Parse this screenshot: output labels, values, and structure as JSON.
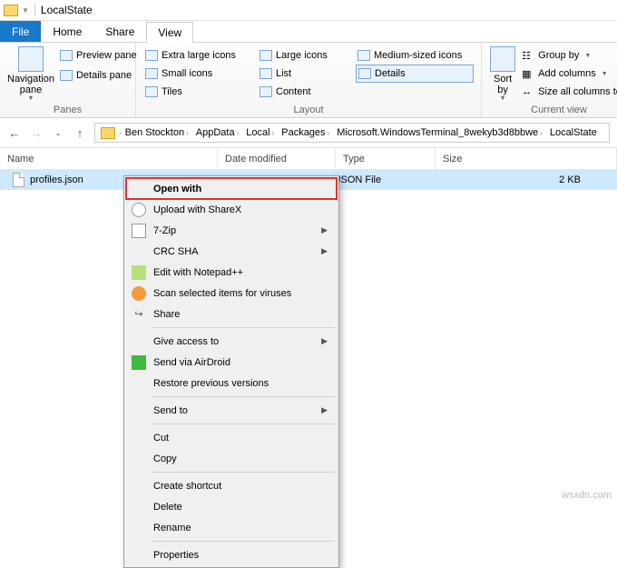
{
  "title": "LocalState",
  "tabs": {
    "file": "File",
    "home": "Home",
    "share": "Share",
    "view": "View"
  },
  "ribbon": {
    "panes": {
      "nav": "Navigation\npane",
      "preview": "Preview pane",
      "details": "Details pane",
      "group": "Panes"
    },
    "layout": {
      "xlarge": "Extra large icons",
      "large": "Large icons",
      "medium": "Medium-sized icons",
      "small": "Small icons",
      "list": "List",
      "details": "Details",
      "tiles": "Tiles",
      "content": "Content",
      "group": "Layout"
    },
    "current": {
      "sort": "Sort\nby",
      "groupby": "Group by",
      "addcols": "Add columns",
      "sizecols": "Size all columns to f",
      "group": "Current view"
    }
  },
  "breadcrumbs": [
    "Ben Stockton",
    "AppData",
    "Local",
    "Packages",
    "Microsoft.WindowsTerminal_8wekyb3d8bbwe",
    "LocalState"
  ],
  "columns": {
    "name": "Name",
    "date": "Date modified",
    "type": "Type",
    "size": "Size"
  },
  "file": {
    "name": "profiles.json",
    "date": "",
    "type": "JSON File",
    "size": "2 KB"
  },
  "context_menu": {
    "open_with": "Open with",
    "sharex": "Upload with ShareX",
    "sevenzip": "7-Zip",
    "crc": "CRC SHA",
    "notepad": "Edit with Notepad++",
    "virus": "Scan selected items for viruses",
    "share": "Share",
    "access": "Give access to",
    "airdroid": "Send via AirDroid",
    "restore": "Restore previous versions",
    "sendto": "Send to",
    "cut": "Cut",
    "copy": "Copy",
    "shortcut": "Create shortcut",
    "delete": "Delete",
    "rename": "Rename",
    "properties": "Properties"
  },
  "watermark": "wsxdn.com"
}
